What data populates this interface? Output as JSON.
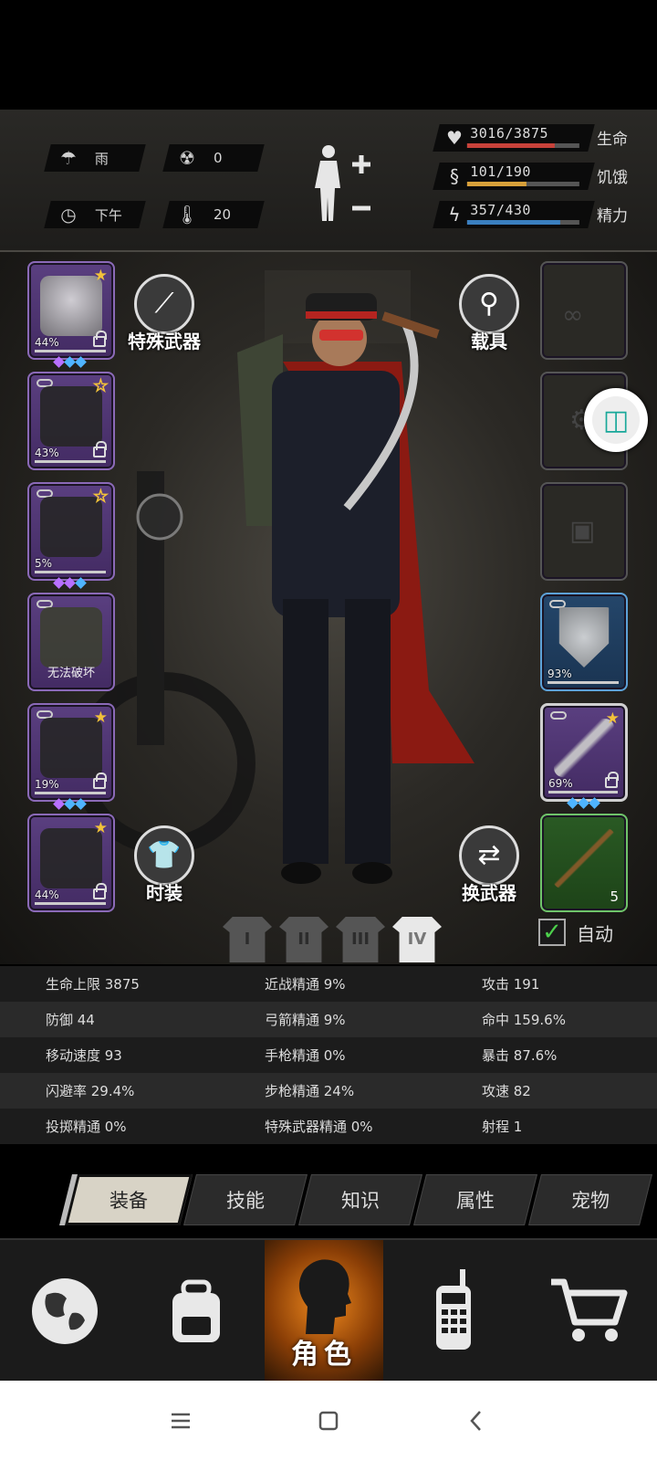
{
  "status": {
    "weather": "雨",
    "radiation": "0",
    "time_of_day": "下午",
    "temperature": "20"
  },
  "vitals": [
    {
      "label": "生命",
      "value": "3016/3875",
      "fraction": 0.778,
      "color": "#c8423a"
    },
    {
      "label": "饥饿",
      "value": "101/190",
      "fraction": 0.532,
      "color": "#d8a03a"
    },
    {
      "label": "精力",
      "value": "357/430",
      "fraction": 0.83,
      "color": "#3a7fc0"
    }
  ],
  "left_slots": [
    {
      "name": "helmet-slot",
      "pct": "44%",
      "star": "filled",
      "link": false,
      "gems": [
        "p",
        "b",
        "b"
      ]
    },
    {
      "name": "shirt-slot",
      "pct": "43%",
      "star": "hollow",
      "link": true,
      "gems": []
    },
    {
      "name": "jacket-slot",
      "pct": "5%",
      "star": "hollow",
      "link": true,
      "gems": [
        "p",
        "p",
        "b"
      ]
    },
    {
      "name": "backpack-slot",
      "label": "无法破坏",
      "link": true
    },
    {
      "name": "pants-slot",
      "pct": "19%",
      "star": "filled",
      "link": true,
      "gems": [
        "p",
        "b",
        "b"
      ]
    },
    {
      "name": "boots-slot",
      "pct": "44%",
      "star": "filled",
      "link": false,
      "gems": []
    }
  ],
  "right_slots": {
    "shield_pct": "93%",
    "weapon_pct": "69%",
    "ammo_count": "5"
  },
  "buttons": {
    "special_weapon": "特殊武器",
    "vehicle": "载具",
    "fashion": "时装",
    "switch_weapon": "换武器",
    "auto": "自动"
  },
  "outfits": [
    "I",
    "II",
    "III",
    "IV"
  ],
  "stats": [
    [
      "生命上限 3875",
      "近战精通 9%",
      "攻击 191"
    ],
    [
      "防御 44",
      "弓箭精通 9%",
      "命中 159.6%"
    ],
    [
      "移动速度 93",
      "手枪精通 0%",
      "暴击 87.6%"
    ],
    [
      "闪避率 29.4%",
      "步枪精通 24%",
      "攻速 82"
    ],
    [
      "投掷精通 0%",
      "特殊武器精通 0%",
      "射程 1"
    ]
  ],
  "tabs": [
    "装备",
    "技能",
    "知识",
    "属性",
    "宠物"
  ],
  "nav": {
    "character": "角色"
  }
}
